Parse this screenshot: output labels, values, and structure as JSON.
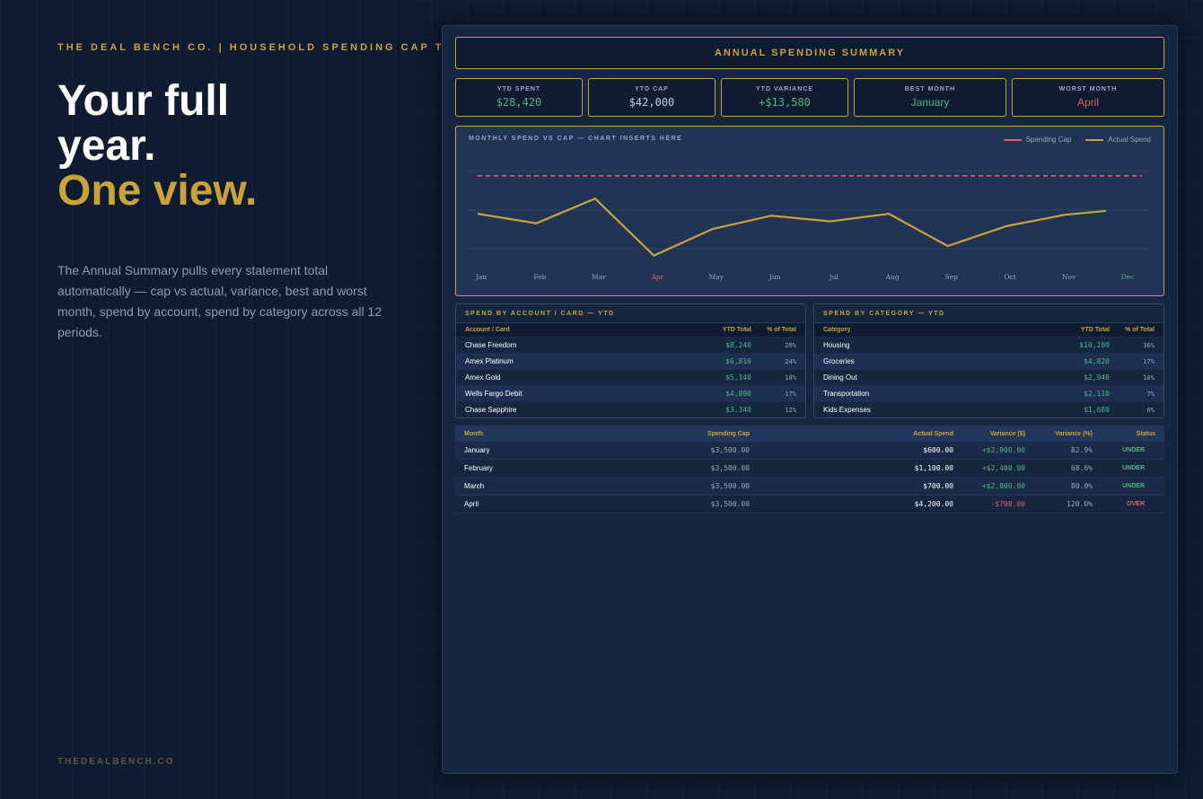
{
  "brand": {
    "tagline": "THE DEAL BENCH CO. | HOUSEHOLD SPENDING CAP TRAC",
    "site": "THEDEALBENCH.CO"
  },
  "hero": {
    "line1": "Your full",
    "line2": "year.",
    "line3": "One view."
  },
  "description": "The Annual Summary pulls every statement total automatically — cap vs actual, variance, best and worst month, spend by account, spend by category across all 12 periods.",
  "summary": {
    "title": "ANNUAL SPENDING SUMMARY"
  },
  "kpis": [
    {
      "label": "YTD SPENT",
      "value": "$28,420",
      "color": "#4fb587"
    },
    {
      "label": "YTD CAP",
      "value": "$42,000",
      "color": "#c4ccd8"
    },
    {
      "label": "YTD VARIANCE",
      "value": "+$13,580",
      "color": "#4fb587"
    },
    {
      "label": "BEST MONTH",
      "value": "January",
      "color": "#4fb587"
    },
    {
      "label": "WORST MONTH",
      "value": "April",
      "color": "#e0606a"
    }
  ],
  "chart_data": {
    "type": "line",
    "title": "MONTHLY SPEND VS CAP — CHART INSERTS HERE",
    "categories": [
      "Jan",
      "Feb",
      "Mar",
      "Apr",
      "May",
      "Jun",
      "Jul",
      "Aug",
      "Sep",
      "Oct",
      "Nov",
      "Dec"
    ],
    "highlight_category": "Apr",
    "highlight_color": "#e0606a",
    "best_category": "Dec",
    "best_color": "#4fb587",
    "series": [
      {
        "name": "Spending Cap",
        "color": "#e0606a",
        "dashed": true,
        "values": [
          3500,
          3500,
          3500,
          3500,
          3500,
          3500,
          3500,
          3500,
          3500,
          3500,
          3500,
          3500
        ]
      },
      {
        "name": "Actual Spend",
        "color": "#c9a33a",
        "dashed": false,
        "values": [
          1500,
          1000,
          2300,
          -700,
          700,
          1400,
          1100,
          1500,
          -200,
          850,
          1450,
          1650
        ]
      }
    ],
    "ylim": [
      -1000,
      4200
    ],
    "grid": true,
    "legend_position": "top-right"
  },
  "accounts": {
    "title": "SPEND BY ACCOUNT / CARD — YTD",
    "headers": [
      "Account / Card",
      "YTD Total",
      "% of Total"
    ],
    "rows": [
      [
        "Chase Freedom",
        "$8,240",
        "29%"
      ],
      [
        "Amex Platinum",
        "$6,810",
        "24%"
      ],
      [
        "Amex Gold",
        "$5,140",
        "18%"
      ],
      [
        "Wells Fargo Debit",
        "$4,890",
        "17%"
      ],
      [
        "Chase Sapphire",
        "$3,340",
        "12%"
      ]
    ]
  },
  "categories": {
    "title": "SPEND BY CATEGORY — YTD",
    "headers": [
      "Category",
      "YTD Total",
      "% of Total"
    ],
    "rows": [
      [
        "Housing",
        "$10,200",
        "36%"
      ],
      [
        "Groceries",
        "$4,820",
        "17%"
      ],
      [
        "Dining Out",
        "$2,940",
        "10%"
      ],
      [
        "Transportation",
        "$2,110",
        "7%"
      ],
      [
        "Kids Expenses",
        "$1,680",
        "6%"
      ]
    ]
  },
  "monthly": {
    "headers": [
      "Month",
      "Spending Cap",
      "Actual Spend",
      "Variance ($)",
      "Variance (%)",
      "Status"
    ],
    "rows": [
      {
        "month": "January",
        "cap": "$3,500.00",
        "actual": "$600.00",
        "variance": "+$2,900.00",
        "pct": "82.9%",
        "status": "UNDER",
        "tone": "pos"
      },
      {
        "month": "February",
        "cap": "$3,500.00",
        "actual": "$1,100.00",
        "variance": "+$2,400.00",
        "pct": "68.6%",
        "status": "UNDER",
        "tone": "pos"
      },
      {
        "month": "March",
        "cap": "$3,500.00",
        "actual": "$700.00",
        "variance": "+$2,800.00",
        "pct": "80.0%",
        "status": "UNDER",
        "tone": "pos"
      },
      {
        "month": "April",
        "cap": "$3,500.00",
        "actual": "$4,200.00",
        "variance": "-$700.00",
        "pct": "120.0%",
        "status": "OVER",
        "tone": "neg"
      }
    ]
  }
}
